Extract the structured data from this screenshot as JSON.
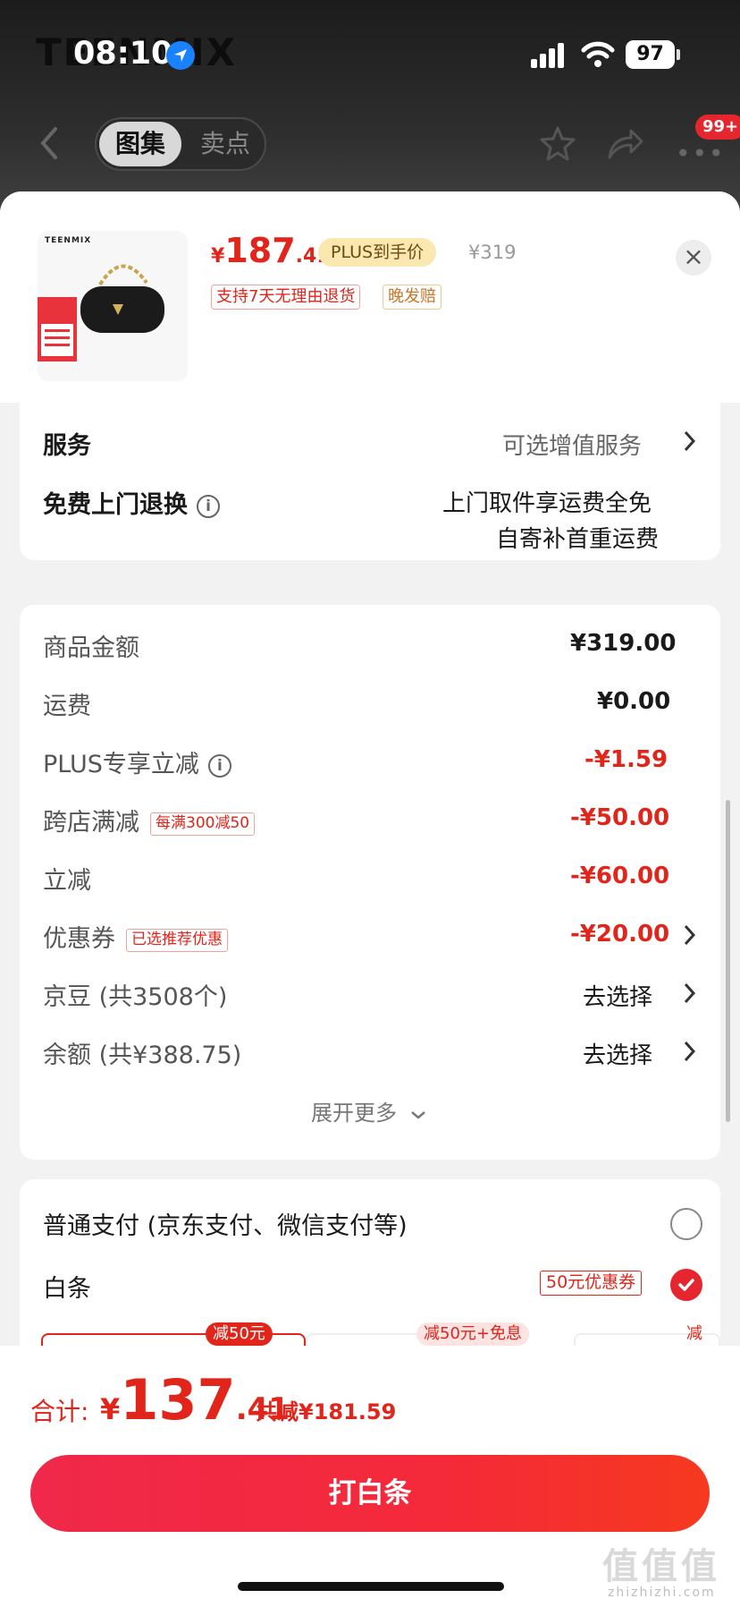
{
  "status_bar": {
    "time": "08:10",
    "battery": "97"
  },
  "background_page": {
    "brand": "TEENMIX",
    "tabs": [
      "图集",
      "卖点"
    ],
    "badge": "99+"
  },
  "product": {
    "thumb_brand": "TEENMIX",
    "price_currency": "¥",
    "price_int": "187",
    "price_dec": ".41",
    "plus_tag": "PLUS到手价",
    "original_price": "¥319",
    "tags": [
      "支持7天无理由退货",
      "晚发赔"
    ]
  },
  "service": {
    "label": "服务",
    "value": "可选增值服务",
    "return_label": "免费上门退换",
    "return_line1": "上门取件享运费全免",
    "return_line2": "自寄补首重运费"
  },
  "amounts": {
    "rows": [
      {
        "label": "商品金额",
        "value": "¥319.00"
      },
      {
        "label": "运费",
        "value": "¥0.00"
      },
      {
        "label": "PLUS专享立减",
        "value": "-¥1.59"
      },
      {
        "label": "跨店满减",
        "tag": "每满300减50",
        "value": "-¥50.00"
      },
      {
        "label": "立减",
        "value": "-¥60.00"
      },
      {
        "label": "优惠券",
        "tag": "已选推荐优惠",
        "value": "-¥20.00"
      },
      {
        "label": "京豆 (共3508个)",
        "value": "去选择"
      },
      {
        "label": "余额 (共¥388.75)",
        "value": "去选择"
      }
    ],
    "expand": "展开更多"
  },
  "payment": {
    "normal_label": "普通支付 (京东支付、微信支付等)",
    "baitiao_label": "白条",
    "baitiao_coupon": "50元优惠券",
    "peek_tags": [
      "减50元",
      "减50元+免息",
      "减"
    ]
  },
  "footer": {
    "total_label": "合计:",
    "currency": "¥",
    "total_int": "137",
    "total_dec": ".41",
    "saving": "共减¥181.59",
    "pay_button": "打白条",
    "watermark": "值值值",
    "watermark_sub": "zhizhizhi.com"
  },
  "colors": {
    "accent_red": "#e1251b",
    "plus_gold": "#fbe8b0",
    "sheet_bg": "#f2f2f2"
  }
}
